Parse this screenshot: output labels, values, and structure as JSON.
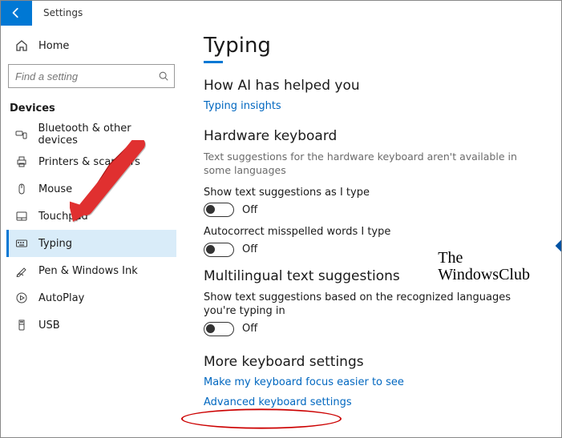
{
  "topbar": {
    "back_aria": "Back",
    "app_title": "Settings"
  },
  "sidebar": {
    "home_label": "Home",
    "search_placeholder": "Find a setting",
    "group_label": "Devices",
    "items": [
      {
        "id": "bluetooth",
        "label": "Bluetooth & other devices",
        "icon": "bluetooth-icon"
      },
      {
        "id": "printers",
        "label": "Printers & scanners",
        "icon": "printer-icon"
      },
      {
        "id": "mouse",
        "label": "Mouse",
        "icon": "mouse-icon"
      },
      {
        "id": "touchpad",
        "label": "Touchpad",
        "icon": "touchpad-icon"
      },
      {
        "id": "typing",
        "label": "Typing",
        "icon": "keyboard-icon",
        "selected": true
      },
      {
        "id": "pen",
        "label": "Pen & Windows Ink",
        "icon": "pen-icon"
      },
      {
        "id": "autoplay",
        "label": "AutoPlay",
        "icon": "autoplay-icon"
      },
      {
        "id": "usb",
        "label": "USB",
        "icon": "usb-icon"
      }
    ]
  },
  "main": {
    "page_title": "Typing",
    "sections": {
      "ai": {
        "heading": "How AI has helped you",
        "link": "Typing insights"
      },
      "hardware": {
        "heading": "Hardware keyboard",
        "subtext": "Text suggestions for the hardware keyboard aren't available in some languages",
        "toggles": [
          {
            "label": "Show text suggestions as I type",
            "state": "Off"
          },
          {
            "label": "Autocorrect misspelled words I type",
            "state": "Off"
          }
        ]
      },
      "multilingual": {
        "heading": "Multilingual text suggestions",
        "toggle": {
          "label": "Show text suggestions based on the recognized languages you're typing in",
          "state": "Off"
        }
      },
      "more": {
        "heading": "More keyboard settings",
        "links": [
          "Make my keyboard focus easier to see",
          "Advanced keyboard settings"
        ]
      }
    }
  },
  "watermark": {
    "line1": "The",
    "line2": "WindowsClub"
  }
}
